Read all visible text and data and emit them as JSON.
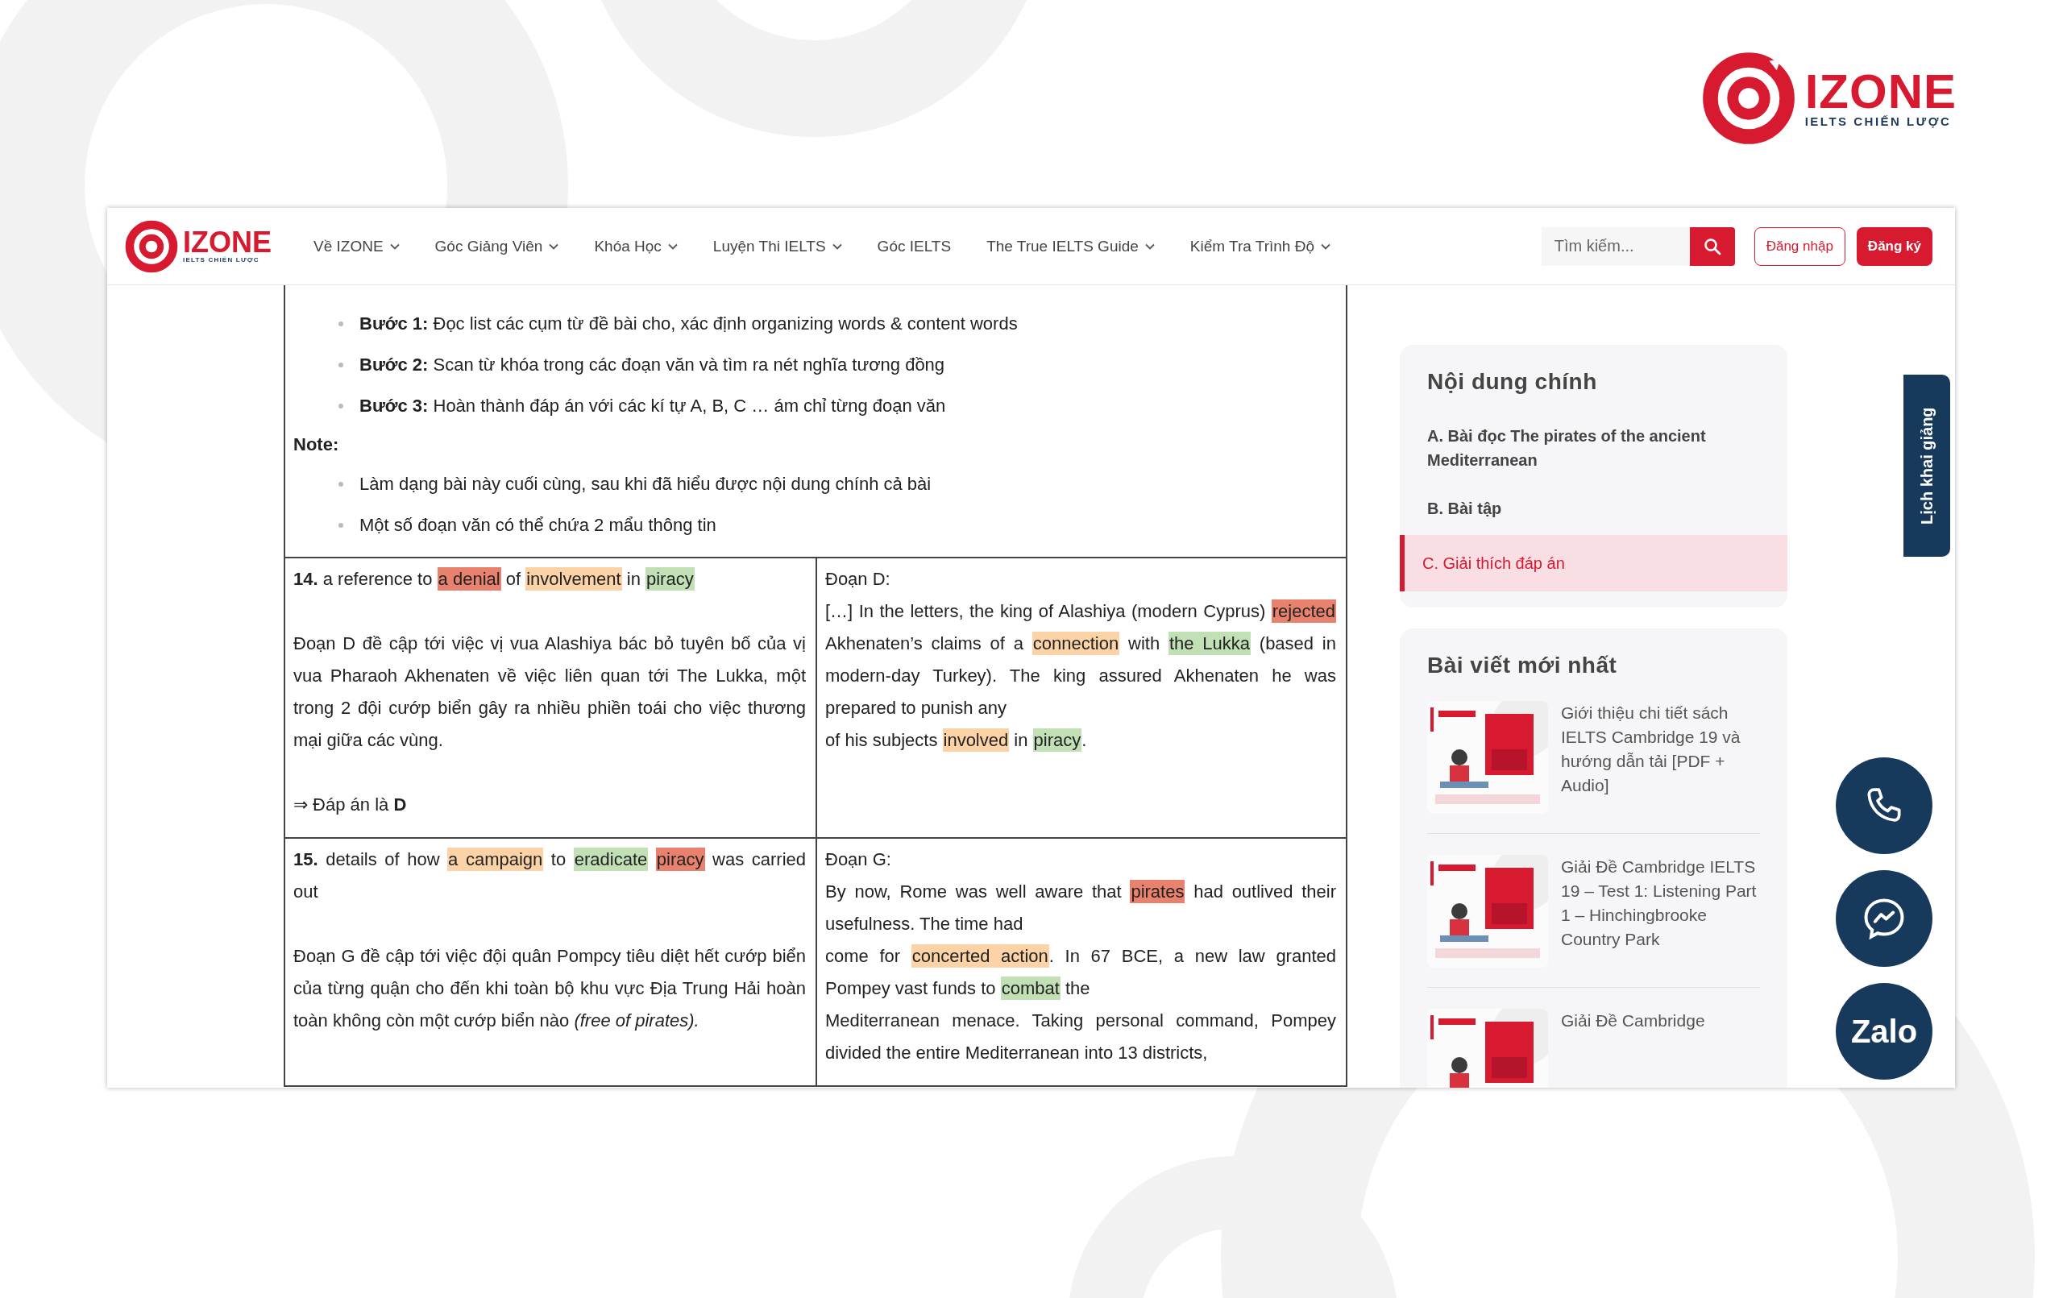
{
  "brand_logo": {
    "name": "IZONE",
    "tagline": "IELTS CHIẾN LƯỢC"
  },
  "site_header": {
    "logo": {
      "name": "IZONE",
      "tagline": "IELTS CHIẾN LƯỢC"
    },
    "nav": [
      {
        "label": "Về IZONE",
        "has_dropdown": true
      },
      {
        "label": "Góc Giảng Viên",
        "has_dropdown": true
      },
      {
        "label": "Khóa Học",
        "has_dropdown": true
      },
      {
        "label": "Luyện Thi IELTS",
        "has_dropdown": true
      },
      {
        "label": "Góc IELTS",
        "has_dropdown": false
      },
      {
        "label": "The True IELTS Guide",
        "has_dropdown": true
      },
      {
        "label": "Kiểm Tra Trình Độ",
        "has_dropdown": true
      }
    ],
    "search": {
      "placeholder": "Tìm kiếm..."
    },
    "login_button": "Đăng nhập",
    "signup_button": "Đăng ký"
  },
  "article": {
    "steps": [
      {
        "label": "Bước 1:",
        "text": "Đọc list các cụm từ đề bài cho, xác định organizing words & content words"
      },
      {
        "label": "Bước 2:",
        "text": "Scan từ khóa trong các đoạn văn và tìm ra nét nghĩa tương đồng"
      },
      {
        "label": "Bước 3:",
        "text": "Hoàn thành đáp án với các kí tự A, B, C … ám chỉ từng đoạn văn"
      }
    ],
    "note_label": "Note:",
    "notes": [
      "Làm dạng bài này cuối cùng, sau khi đã hiểu được nội dung chính cả bài",
      "Một số đoạn văn có thể chứa 2 mẩu thông tin"
    ],
    "answer_table": {
      "rows": [
        {
          "question": [
            [
              [
                {
                  "t": "**14.** a reference to "
                },
                {
                  "t": "a denial",
                  "color": "#e8826e"
                },
                {
                  "t": " of "
                },
                {
                  "t": "involvement",
                  "color": "#fcd3a6"
                },
                {
                  "t": " in "
                },
                {
                  "t": "piracy",
                  "color": "#c2e0b6"
                }
              ]
            ],
            [
              [
                {
                  "t": "Đoạn D đề cập tới việc vị vua Alashiya bác bỏ tuyên bố của vị vua Pharaoh Akhenaten về việc liên quan tới The Lukka, một trong 2 đội cướp biển gây ra nhiều phiền toái cho việc thương mại giữa các vùng."
                }
              ]
            ],
            [
              [
                {
                  "t": "⇒ Đáp án là **D**"
                }
              ]
            ]
          ],
          "passage": [
            [
              [
                {
                  "t": "Đoạn D:"
                }
              ],
              [
                {
                  "t": "[…] In the letters, the king of Alashiya (modern Cyprus) "
                },
                {
                  "t": "rejected",
                  "color": "#e8826e"
                },
                {
                  "t": " Akhenaten’s claims of a "
                },
                {
                  "t": "connection",
                  "color": "#fcd3a6"
                },
                {
                  "t": " with "
                },
                {
                  "t": "the Lukka",
                  "color": "#c2e0b6"
                },
                {
                  "t": " (based in modern-day Turkey). The king assured Akhenaten he was prepared to punish any"
                }
              ],
              [
                {
                  "t": "of his subjects "
                },
                {
                  "t": "involved",
                  "color": "#fcd3a6"
                },
                {
                  "t": " in "
                },
                {
                  "t": "piracy",
                  "color": "#c2e0b6"
                },
                {
                  "t": "."
                }
              ]
            ]
          ]
        },
        {
          "question": [
            [
              [
                {
                  "t": "**15.** details of how "
                },
                {
                  "t": "a campaign",
                  "color": "#fcd3a6"
                },
                {
                  "t": " to "
                },
                {
                  "t": "eradicate",
                  "color": "#c2e0b6"
                },
                {
                  "t": " piracy",
                  "color": "#e8826e"
                },
                {
                  "t": " was carried out"
                }
              ]
            ],
            [
              [
                {
                  "t": "Đoạn G đề cập tới việc đội quân Pompcy tiêu diệt hết cướp biển của từng quận cho đến khi toàn bộ khu vực Địa Trung Hải hoàn toàn không còn một cướp biển nào *(free of pirates).*"
                }
              ]
            ]
          ],
          "passage": [
            [
              [
                {
                  "t": "Đoạn G:"
                }
              ],
              [
                {
                  "t": "By now, Rome was well aware that "
                },
                {
                  "t": "pirates",
                  "color": "#e8826e"
                },
                {
                  "t": " had outlived their usefulness. The time had"
                }
              ],
              [
                {
                  "t": "come for "
                },
                {
                  "t": "concerted action",
                  "color": "#fcd3a6"
                },
                {
                  "t": ". In 67 BCE, a new law granted Pompey vast funds to "
                },
                {
                  "t": "combat",
                  "color": "#c2e0b6"
                },
                {
                  "t": " the"
                }
              ],
              [
                {
                  "t": "Mediterranean menace. Taking personal command, Pompey divided the entire Mediterranean into 13 districts,"
                }
              ]
            ]
          ]
        }
      ]
    }
  },
  "sidebar": {
    "toc": {
      "title": "Nội dung chính",
      "items": [
        {
          "label": "A. Bài đọc The pirates of the ancient Mediterranean",
          "selected": false
        },
        {
          "label": "B. Bài tập",
          "selected": false
        },
        {
          "label": "C. Giải thích đáp án",
          "selected": true
        }
      ]
    },
    "latest": {
      "title": "Bài viết mới nhất",
      "posts": [
        {
          "title": "Giới thiệu chi tiết sách IELTS Cambridge 19 và hướng dẫn tải [PDF + Audio]",
          "kind": "picture"
        },
        {
          "title": "Giải Đề Cambridge IELTS 19 – Test 1: Listening Part 1 – Hinchingbrooke Country Park",
          "kind": "picture"
        },
        {
          "title": "Giải Đề Cambridge",
          "kind": "picture"
        }
      ]
    }
  },
  "schedule_tab": "Lịch khai giảng",
  "float_buttons": [
    {
      "kind": "phone"
    },
    {
      "kind": "messenger"
    },
    {
      "kind": "zalo",
      "label": "Zalo"
    }
  ]
}
